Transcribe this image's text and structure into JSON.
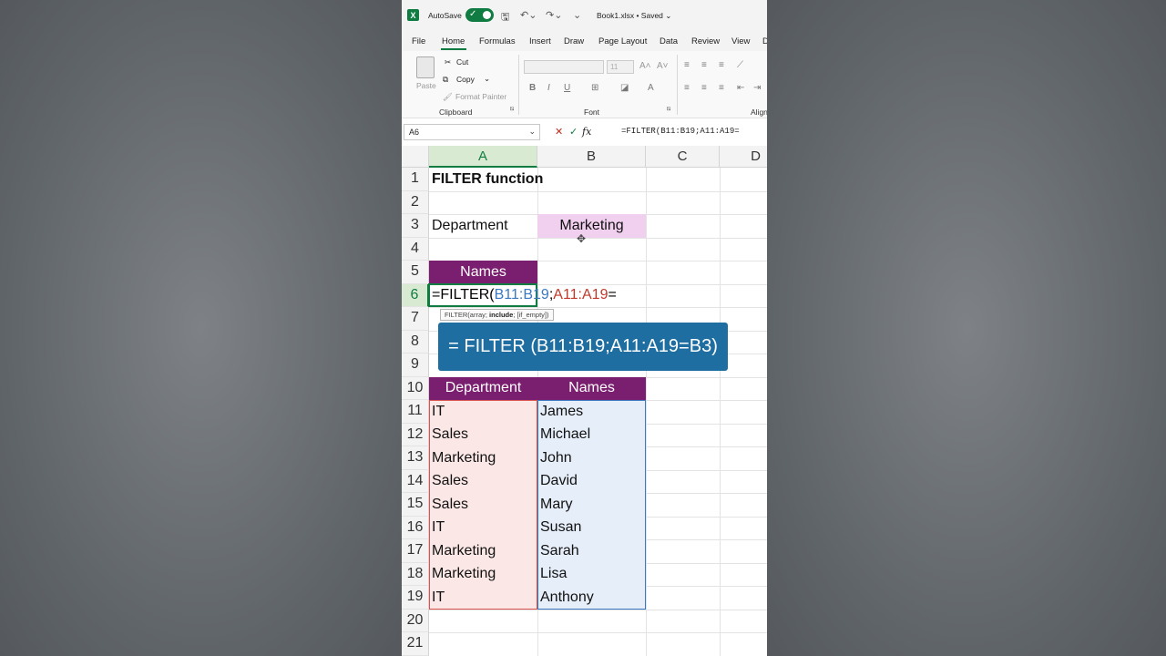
{
  "titlebar": {
    "autosave_label": "AutoSave",
    "filename": "Book1.xlsx • Saved ⌄"
  },
  "tabs": [
    {
      "label": "File"
    },
    {
      "label": "Home"
    },
    {
      "label": "Formulas"
    },
    {
      "label": "Insert"
    },
    {
      "label": "Draw"
    },
    {
      "label": "Page Layout"
    },
    {
      "label": "Data"
    },
    {
      "label": "Review"
    },
    {
      "label": "View"
    },
    {
      "label": "D"
    }
  ],
  "ribbon": {
    "paste": "Paste",
    "cut": "Cut",
    "copy": "Copy",
    "format_painter": "Format Painter",
    "clipboard_label": "Clipboard",
    "font_size": "11",
    "font_label": "Font",
    "align_label": "Align",
    "bold": "B",
    "italic": "I",
    "underline": "U"
  },
  "formula_bar": {
    "name_box": "A6",
    "fx": "fx",
    "formula": "=FILTER(B11:B19;A11:A19="
  },
  "columns": [
    "A",
    "B",
    "C",
    "D"
  ],
  "rows": [
    "1",
    "2",
    "3",
    "4",
    "5",
    "6",
    "7",
    "8",
    "9",
    "10",
    "11",
    "12",
    "13",
    "14",
    "15",
    "16",
    "17",
    "18",
    "19",
    "20",
    "21"
  ],
  "cells": {
    "a1": "FILTER function",
    "a3": "Department",
    "b3": "Marketing",
    "a5": "Names",
    "a6_prefix": "=FILTER(",
    "a6_ref1": "B11:B19",
    "a6_sep": ";",
    "a6_ref2": "A11:A19",
    "a6_suffix": "=",
    "a10": "Department",
    "b10": "Names"
  },
  "table": [
    {
      "department": "IT",
      "name": "James"
    },
    {
      "department": "Sales",
      "name": "Michael"
    },
    {
      "department": "Marketing",
      "name": "John"
    },
    {
      "department": "Sales",
      "name": "David"
    },
    {
      "department": "Sales",
      "name": "Mary"
    },
    {
      "department": "IT",
      "name": "Susan"
    },
    {
      "department": "Marketing",
      "name": "Sarah"
    },
    {
      "department": "Marketing",
      "name": "Lisa"
    },
    {
      "department": "IT",
      "name": "Anthony"
    }
  ],
  "tooltip": {
    "fn": "FILTER(array; ",
    "bold": "include",
    "rest": "; [if_empty])"
  },
  "banner": "= FILTER (B11:B19;A11:A19=B3)",
  "colors": {
    "excel_green": "#107c41",
    "header_purple": "#7a1f6f",
    "criteria_pink": "#f1cfee",
    "banner_blue": "#1f6ea1"
  }
}
